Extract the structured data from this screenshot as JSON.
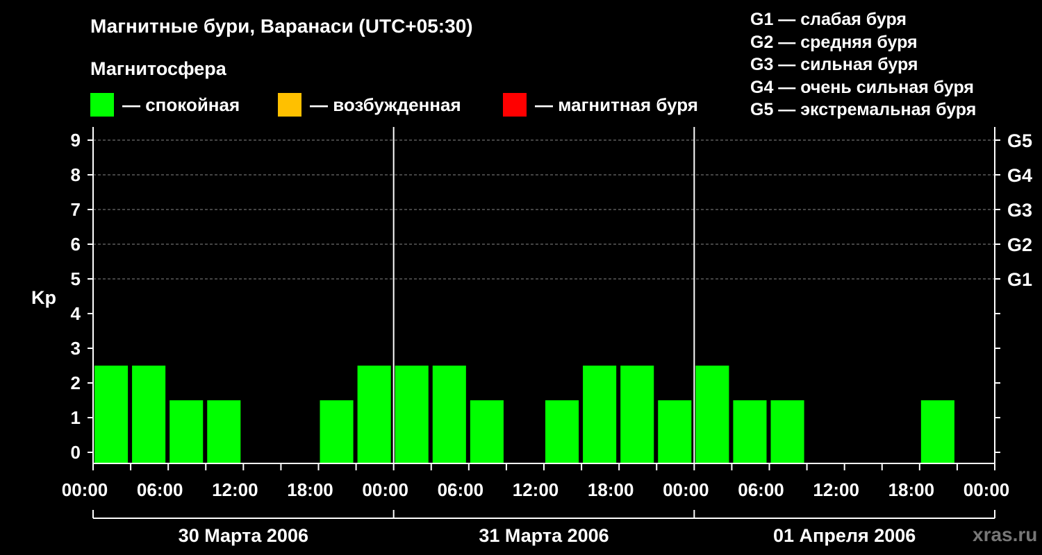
{
  "header": {
    "title": "Магнитные бури, Варанаси (UTC+05:30)",
    "subtitle": "Магнитосфера"
  },
  "legend": [
    {
      "label": "— спокойная",
      "color": "#00ff00"
    },
    {
      "label": "— возбужденная",
      "color": "#ffc000"
    },
    {
      "label": "— магнитная буря",
      "color": "#ff0000"
    }
  ],
  "storm_scale": [
    "G1 — слабая буря",
    "G2 — средняя буря",
    "G3 — сильная буря",
    "G4 — очень сильная буря",
    "G5 — экстремальная буря"
  ],
  "watermark": "xras.ru",
  "chart_data": {
    "type": "bar",
    "title": "Магнитные бури, Варанаси (UTC+05:30)",
    "ylabel": "Kp",
    "ylim": [
      0,
      9
    ],
    "yticks": [
      0,
      1,
      2,
      3,
      4,
      5,
      6,
      7,
      8,
      9
    ],
    "right_ticks": [
      {
        "value": 5,
        "label": "G1"
      },
      {
        "value": 6,
        "label": "G2"
      },
      {
        "value": 7,
        "label": "G3"
      },
      {
        "value": 8,
        "label": "G4"
      },
      {
        "value": 9,
        "label": "G5"
      }
    ],
    "x_tick_labels": [
      "00:00",
      "06:00",
      "12:00",
      "18:00",
      "00:00",
      "06:00",
      "12:00",
      "18:00",
      "00:00",
      "06:00",
      "12:00",
      "18:00",
      "00:00"
    ],
    "days": [
      "30 Марта 2006",
      "31 Марта 2006",
      "01 Апреля 2006"
    ],
    "bar_interval_hours": 3,
    "values": [
      2,
      2,
      1,
      1,
      0,
      0,
      1,
      2,
      2,
      2,
      1,
      0,
      1,
      2,
      2,
      1,
      2,
      1,
      1,
      0,
      0,
      0,
      1,
      0
    ],
    "grid": "dashed horizontal at 5–9",
    "colors": {
      "quiet": "#00ff00",
      "active": "#ffc000",
      "storm": "#ff0000"
    }
  }
}
